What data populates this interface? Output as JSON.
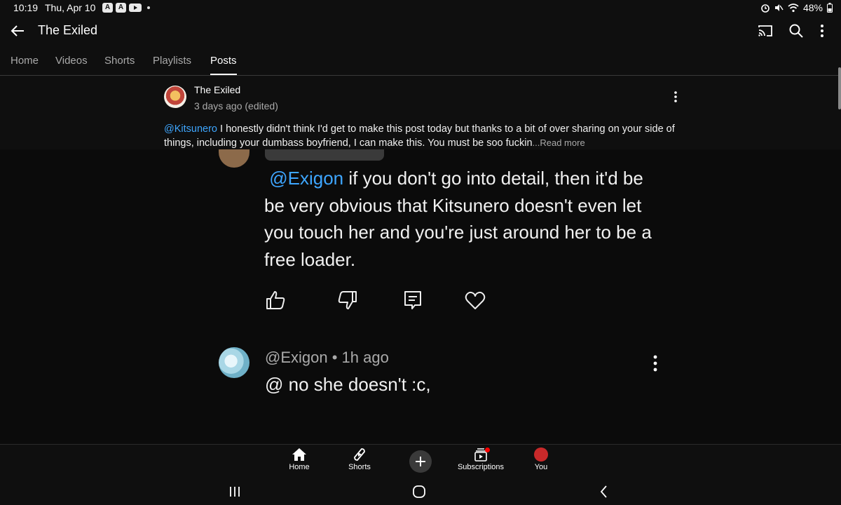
{
  "status_bar": {
    "time": "10:19",
    "date": "Thu, Apr 10",
    "battery": "48%",
    "icons": [
      "app-a-icon",
      "app-a-icon",
      "youtube-icon",
      "dot",
      "alarm-icon",
      "mute-icon",
      "wifi-icon",
      "battery-icon"
    ]
  },
  "app_bar": {
    "title": "The Exiled",
    "icons": [
      "back-arrow-icon",
      "cast-icon",
      "search-icon",
      "more-vert-icon"
    ]
  },
  "tabs": [
    {
      "label": "Home",
      "active": false
    },
    {
      "label": "Videos",
      "active": false
    },
    {
      "label": "Shorts",
      "active": false
    },
    {
      "label": "Playlists",
      "active": false
    },
    {
      "label": "Posts",
      "active": true
    }
  ],
  "post": {
    "author": "The Exiled",
    "meta": "3 days ago (edited)",
    "mention": "@Kitsunero",
    "text": "  I honestly didn't think I'd get to make this post today but thanks to a bit of over sharing on your side of things, including your dumbass boyfriend, I can make this. You must be soo fuckin",
    "read_more": "...Read more"
  },
  "embedded_image": {
    "comment_mention": "@Exigon",
    "comment_text": " if you don't go into detail, then it'd be be very obvious that Kitsunero doesn't even let you touch her and you're just around her to be a free loader.",
    "action_icons": [
      "thumbs-up-icon",
      "thumbs-down-icon",
      "reply-icon",
      "heart-icon"
    ],
    "reply_meta": "@Exigon • 1h ago",
    "reply_text": "@ no she doesn't :c,"
  },
  "bottom_nav": [
    {
      "label": "Home",
      "icon": "home-icon"
    },
    {
      "label": "Shorts",
      "icon": "shorts-icon"
    },
    {
      "label": "",
      "icon": "create-plus-icon"
    },
    {
      "label": "Subscriptions",
      "icon": "subscriptions-icon"
    },
    {
      "label": "You",
      "icon": "avatar"
    }
  ],
  "colors": {
    "background": "#0f0f0f",
    "mention": "#3ea6ff",
    "secondary_text": "#aaaaaa",
    "notification": "#ff0000"
  }
}
